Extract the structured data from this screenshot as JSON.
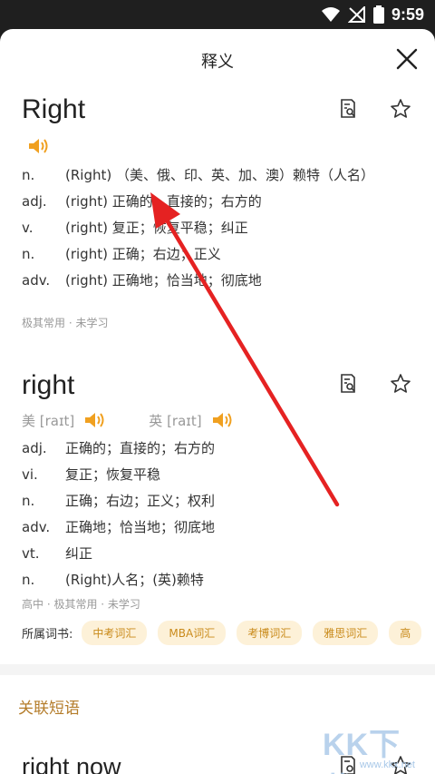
{
  "status": {
    "time": "9:59"
  },
  "header": {
    "title": "释义"
  },
  "entry1": {
    "word": "Right",
    "defs": [
      {
        "pos": "n.",
        "text": "(Right) （美、俄、印、英、加、澳）赖特（人名）"
      },
      {
        "pos": "adj.",
        "text": "(right) 正确的；直接的；右方的"
      },
      {
        "pos": "v.",
        "text": "(right) 复正；恢复平稳；纠正"
      },
      {
        "pos": "n.",
        "text": "(right) 正确；右边；正义"
      },
      {
        "pos": "adv.",
        "text": "(right) 正确地；恰当地；彻底地"
      }
    ],
    "meta": "极其常用 · 未学习"
  },
  "entry2": {
    "word": "right",
    "pron_us": "美 [raɪt]",
    "pron_uk": "英 [raɪt]",
    "defs": [
      {
        "pos": "adj.",
        "text": "正确的；直接的；右方的"
      },
      {
        "pos": "vi.",
        "text": "复正；恢复平稳"
      },
      {
        "pos": "n.",
        "text": "正确；右边；正义；权利"
      },
      {
        "pos": "adv.",
        "text": "正确地；恰当地；彻底地"
      },
      {
        "pos": "vt.",
        "text": "纠正"
      },
      {
        "pos": "n.",
        "text": "(Right)人名；(英)赖特"
      }
    ],
    "meta": "高中 · 极其常用 · 未学习",
    "books_label": "所属词书:",
    "books": [
      "中考词汇",
      "MBA词汇",
      "考博词汇",
      "雅思词汇",
      "高"
    ]
  },
  "related": {
    "title": "关联短语",
    "first_phrase": "right now"
  },
  "watermark": {
    "big": "KK下载",
    "small": "www.kkx.net"
  },
  "colors": {
    "accent": "#f0a020",
    "section": "#b47c2a",
    "arrow": "#e52222"
  }
}
